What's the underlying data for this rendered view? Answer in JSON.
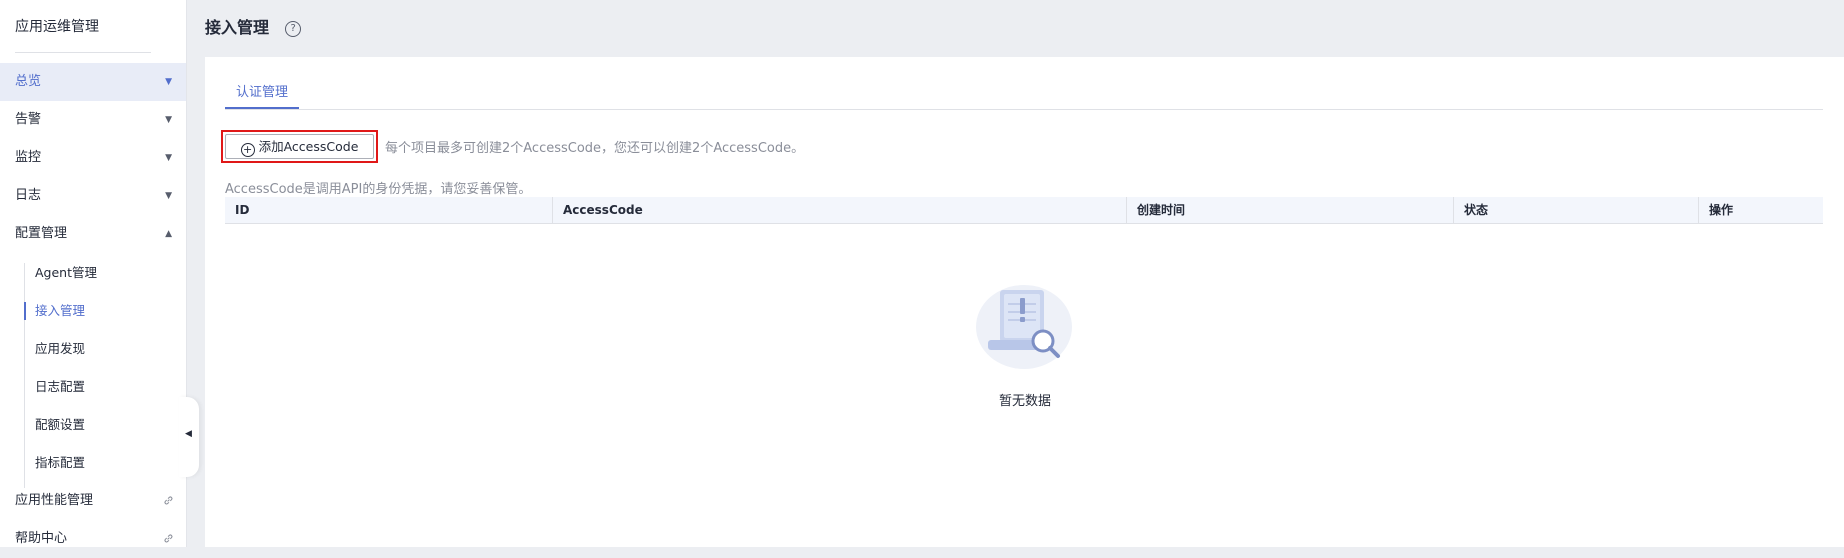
{
  "sidebar": {
    "title": "应用运维管理",
    "items": [
      {
        "label": "总览",
        "arrow": "▼",
        "active": true
      },
      {
        "label": "告警",
        "arrow": "▼"
      },
      {
        "label": "监控",
        "arrow": "▼"
      },
      {
        "label": "日志",
        "arrow": "▼"
      },
      {
        "label": "配置管理",
        "arrow": "▲"
      }
    ],
    "subitems": [
      {
        "label": "Agent管理"
      },
      {
        "label": "接入管理",
        "active": true
      },
      {
        "label": "应用发现"
      },
      {
        "label": "日志配置"
      },
      {
        "label": "配额设置"
      },
      {
        "label": "指标配置"
      }
    ],
    "links": [
      {
        "label": "应用性能管理",
        "icon": "link-icon"
      },
      {
        "label": "帮助中心",
        "icon": "link-icon"
      }
    ],
    "collapse_glyph": "◀"
  },
  "header": {
    "title": "接入管理",
    "help_glyph": "?"
  },
  "tabs": [
    {
      "label": "认证管理",
      "active": true
    }
  ],
  "toolbar": {
    "add_plus": "+",
    "add_label": "添加AccessCode",
    "hint": "每个项目最多可创建2个AccessCode，您还可以创建2个AccessCode。",
    "note": "AccessCode是调用API的身份凭据，请您妥善保管。"
  },
  "table": {
    "columns": [
      "ID",
      "AccessCode",
      "创建时间",
      "状态",
      "操作"
    ],
    "rows": [],
    "empty_text": "暂无数据"
  },
  "colors": {
    "accent": "#526ecc",
    "highlight_border": "#e01818",
    "muted_text": "#8a8e99"
  }
}
